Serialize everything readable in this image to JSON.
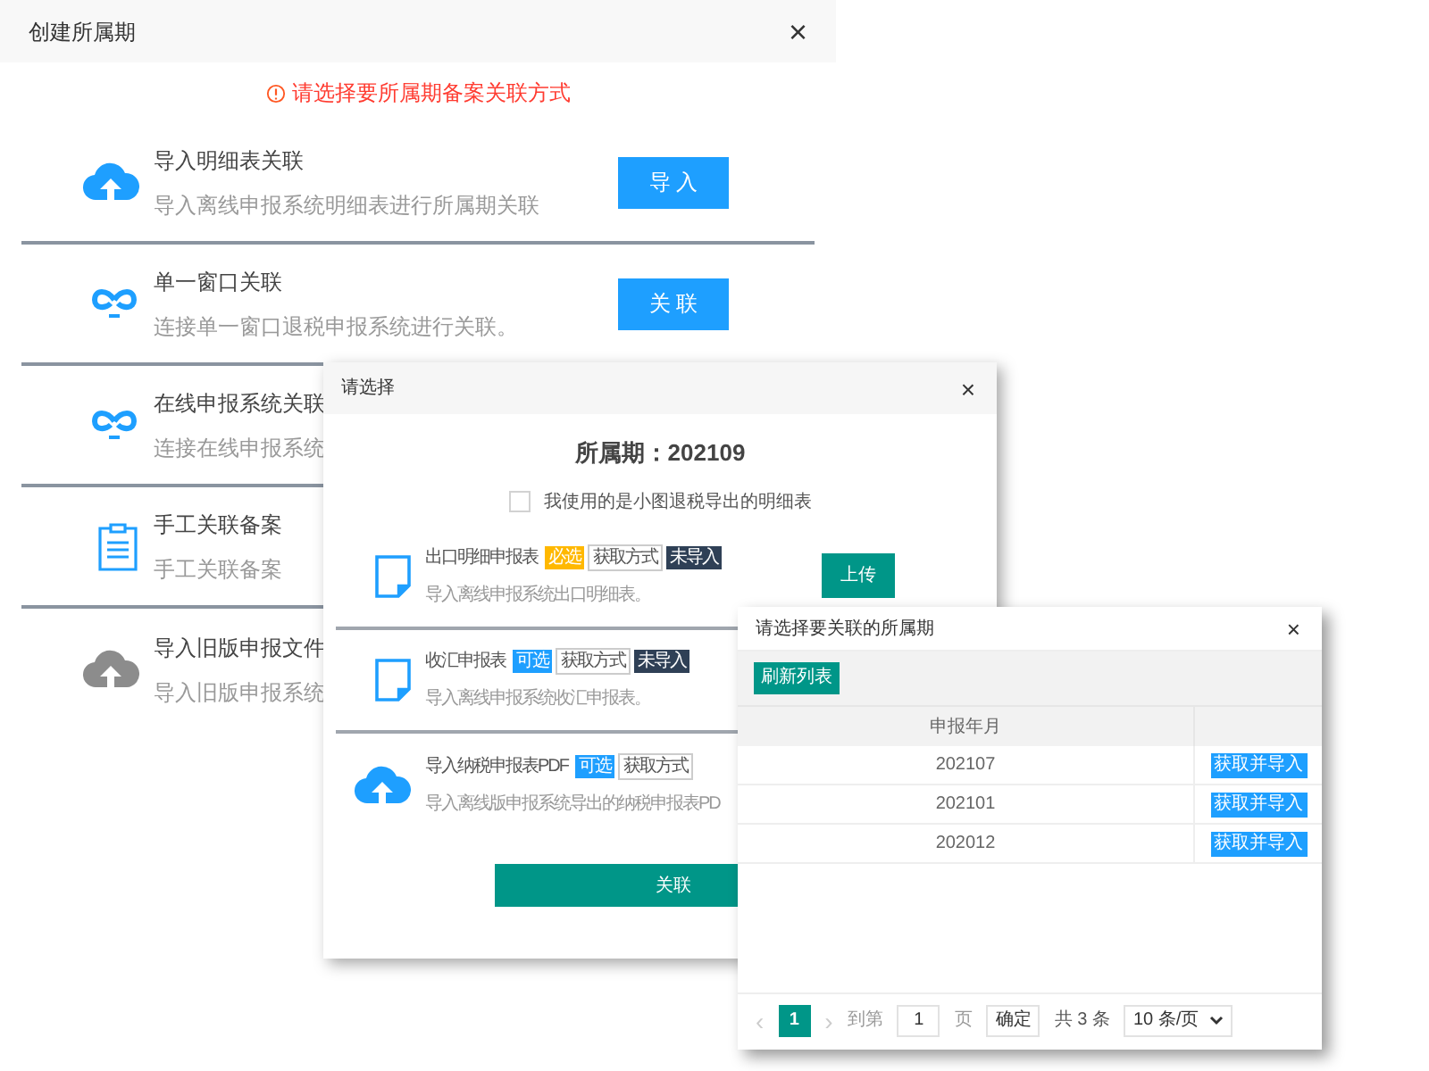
{
  "main_dialog": {
    "title": "创建所属期",
    "close": "×",
    "notice": "请选择要所属期备案关联方式",
    "options": [
      {
        "kind": "cloud",
        "disabled": false,
        "title": "导入明细表关联",
        "description": "导入离线申报系统明细表进行所属期关联",
        "button": "导 入"
      },
      {
        "kind": "link",
        "disabled": false,
        "title": "单一窗口关联",
        "description": "连接单一窗口退税申报系统进行关联。",
        "button": "关 联"
      },
      {
        "kind": "link",
        "disabled": false,
        "title": "在线申报系统关联",
        "description": "连接在线申报系统"
      },
      {
        "kind": "clipboard",
        "disabled": false,
        "title": "手工关联备案",
        "description": "手工关联备案"
      },
      {
        "kind": "cloud",
        "disabled": true,
        "title": "导入旧版申报文件",
        "description": "导入旧版申报系统"
      }
    ]
  },
  "select_dialog": {
    "title": "请选择",
    "close": "×",
    "period": "所属期：202109",
    "checkbox": {
      "label": "我使用的是小图退税导出的明细表",
      "checked": false
    },
    "items": [
      {
        "kind": "file",
        "title": "出口明细申报表",
        "tags": [
          {
            "text": "必选",
            "kind": "required"
          },
          {
            "text": "获取方式",
            "kind": "method"
          },
          {
            "text": "未导入",
            "kind": "status"
          }
        ],
        "description": "导入离线申报系统出口明细表。",
        "button": "上传"
      },
      {
        "kind": "file",
        "title": "收汇申报表",
        "tags": [
          {
            "text": "可选",
            "kind": "optional"
          },
          {
            "text": "获取方式",
            "kind": "method"
          },
          {
            "text": "未导入",
            "kind": "status"
          }
        ],
        "description": "导入离线申报系统收汇申报表。"
      },
      {
        "kind": "cloud",
        "title": "导入纳税申报表PDF",
        "tags": [
          {
            "text": "可选",
            "kind": "optional"
          },
          {
            "text": "获取方式",
            "kind": "method"
          }
        ],
        "description": "导入离线版申报系统导出的纳税申报表PD"
      }
    ],
    "submit": "关联"
  },
  "period_dialog": {
    "title": "请选择要关联的所属期",
    "close": "×",
    "refresh": "刷新列表",
    "table": {
      "columns": [
        "申报年月"
      ],
      "rows": [
        {
          "period": "202107",
          "action": "获取并导入"
        },
        {
          "period": "202101",
          "action": "获取并导入"
        },
        {
          "period": "202012",
          "action": "获取并导入"
        }
      ]
    },
    "pagination": {
      "prev": "‹",
      "pages": [
        {
          "label": "1",
          "selected": true
        }
      ],
      "next": "›",
      "goto": "到第",
      "page_input": "1",
      "page_unit": "页",
      "confirm": "确定",
      "total": "共 3 条",
      "page_size": "10 条/页"
    }
  }
}
